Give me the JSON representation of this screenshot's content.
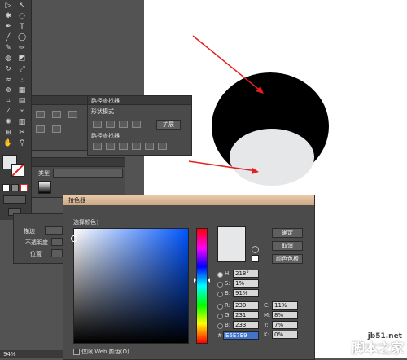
{
  "panels": {
    "pathfinder": {
      "title": "路径查找器",
      "shape_modes_label": "形状模式",
      "expand_label": "扩展",
      "pathfinders_label": "路径查找器"
    },
    "appearance": {
      "type_label": "类型",
      "opacity_label": "不透明度",
      "position_label": "位置"
    },
    "swatch_bar": {
      "fill_label": "描边"
    }
  },
  "color_picker": {
    "title": "拾色器",
    "select_color_label": "选择颜色：",
    "ok_label": "确定",
    "cancel_label": "取消",
    "swatches_label": "颜色色板",
    "hsb": {
      "h_label": "H:",
      "h_value": "218°",
      "s_label": "S:",
      "s_value": "1%",
      "b_label": "B:",
      "b_value": "91%"
    },
    "rgb": {
      "r_label": "R:",
      "r_value": "230",
      "g_label": "G:",
      "g_value": "231",
      "b_label": "B:",
      "b_value": "233"
    },
    "cmyk": {
      "c_label": "C:",
      "c_value": "11%",
      "m_label": "M:",
      "m_value": "8%",
      "y_label": "Y:",
      "y_value": "7%",
      "k_label": "K:",
      "k_value": "0%"
    },
    "hex_label": "#",
    "hex_value": "E6E7E9",
    "web_only_label": "仅限 Web 颜色(O)"
  },
  "status": {
    "zoom": "94%"
  },
  "watermark": {
    "url": "jb51.net",
    "text": "脚本之家"
  },
  "colors": {
    "accent": "#e61e1e",
    "selected_fill": "#e6e7e9"
  }
}
